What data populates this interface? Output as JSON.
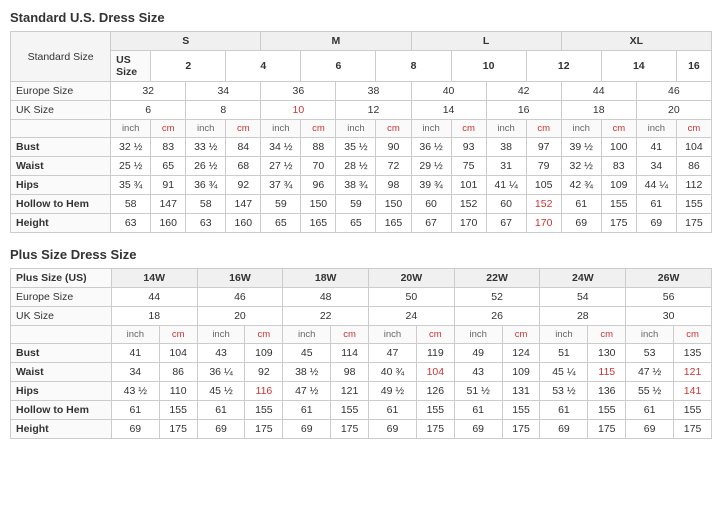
{
  "standard": {
    "title": "Standard U.S. Dress Size",
    "size_groups": [
      "S",
      "M",
      "L",
      "XL"
    ],
    "headers": {
      "standard_size": "Standard Size",
      "us_size": "US Size",
      "europe_size": "Europe Size",
      "uk_size": "UK Size",
      "bust": "Bust",
      "waist": "Waist",
      "hips": "Hips",
      "hollow_to_hem": "Hollow to Hem",
      "height": "Height"
    },
    "us_sizes": [
      "2",
      "4",
      "6",
      "8",
      "10",
      "12",
      "14",
      "16"
    ],
    "europe_sizes": [
      "32",
      "34",
      "36",
      "38",
      "40",
      "42",
      "44",
      "46"
    ],
    "uk_sizes": [
      "6",
      "8",
      "10",
      "12",
      "14",
      "16",
      "18",
      "20"
    ],
    "bust": [
      {
        "inch": "32 ½",
        "cm": "83"
      },
      {
        "inch": "33 ½",
        "cm": "84"
      },
      {
        "inch": "34 ½",
        "cm": "88"
      },
      {
        "inch": "35 ½",
        "cm": "90"
      },
      {
        "inch": "36 ½",
        "cm": "93"
      },
      {
        "inch": "38",
        "cm": "97"
      },
      {
        "inch": "39 ½",
        "cm": "100"
      },
      {
        "inch": "41",
        "cm": "104"
      }
    ],
    "waist": [
      {
        "inch": "25 ½",
        "cm": "65"
      },
      {
        "inch": "26 ½",
        "cm": "68"
      },
      {
        "inch": "27 ½",
        "cm": "70"
      },
      {
        "inch": "28 ½",
        "cm": "72"
      },
      {
        "inch": "29 ½",
        "cm": "75"
      },
      {
        "inch": "31",
        "cm": "79"
      },
      {
        "inch": "32 ½",
        "cm": "83"
      },
      {
        "inch": "34",
        "cm": "86"
      }
    ],
    "hips": [
      {
        "inch": "35 ¾",
        "cm": "91"
      },
      {
        "inch": "36 ¾",
        "cm": "92"
      },
      {
        "inch": "37 ¾",
        "cm": "96"
      },
      {
        "inch": "38 ¾",
        "cm": "98"
      },
      {
        "inch": "39 ¾",
        "cm": "101"
      },
      {
        "inch": "41 ¼",
        "cm": "105"
      },
      {
        "inch": "42 ¾",
        "cm": "109"
      },
      {
        "inch": "44 ¼",
        "cm": "112"
      }
    ],
    "hollow_to_hem": [
      {
        "inch": "58",
        "cm": "147"
      },
      {
        "inch": "58",
        "cm": "147"
      },
      {
        "inch": "59",
        "cm": "150"
      },
      {
        "inch": "59",
        "cm": "150"
      },
      {
        "inch": "60",
        "cm": "152"
      },
      {
        "inch": "60",
        "cm": "152"
      },
      {
        "inch": "61",
        "cm": "155"
      },
      {
        "inch": "61",
        "cm": "155"
      }
    ],
    "height": [
      {
        "inch": "63",
        "cm": "160"
      },
      {
        "inch": "63",
        "cm": "160"
      },
      {
        "inch": "65",
        "cm": "165"
      },
      {
        "inch": "65",
        "cm": "165"
      },
      {
        "inch": "67",
        "cm": "170"
      },
      {
        "inch": "67",
        "cm": "170"
      },
      {
        "inch": "69",
        "cm": "175"
      },
      {
        "inch": "69",
        "cm": "175"
      }
    ]
  },
  "plus": {
    "title": "Plus Size Dress Size",
    "headers": {
      "plus_size": "Plus Size (US)",
      "europe_size": "Europe Size",
      "uk_size": "UK Size",
      "bust": "Bust",
      "waist": "Waist",
      "hips": "Hips",
      "hollow_to_hem": "Hollow to Hem",
      "height": "Height"
    },
    "plus_sizes": [
      "14W",
      "16W",
      "18W",
      "20W",
      "22W",
      "24W",
      "26W"
    ],
    "europe_sizes": [
      "44",
      "46",
      "48",
      "50",
      "52",
      "54",
      "56"
    ],
    "uk_sizes": [
      "18",
      "20",
      "22",
      "24",
      "26",
      "28",
      "30"
    ],
    "bust": [
      {
        "inch": "41",
        "cm": "104"
      },
      {
        "inch": "43",
        "cm": "109"
      },
      {
        "inch": "45",
        "cm": "114"
      },
      {
        "inch": "47",
        "cm": "119"
      },
      {
        "inch": "49",
        "cm": "124"
      },
      {
        "inch": "51",
        "cm": "130"
      },
      {
        "inch": "53",
        "cm": "135"
      }
    ],
    "waist": [
      {
        "inch": "34",
        "cm": "86"
      },
      {
        "inch": "36 ¼",
        "cm": "92"
      },
      {
        "inch": "38 ½",
        "cm": "98"
      },
      {
        "inch": "40 ¾",
        "cm": "104"
      },
      {
        "inch": "43",
        "cm": "109"
      },
      {
        "inch": "45 ¼",
        "cm": "115"
      },
      {
        "inch": "47 ½",
        "cm": "121"
      }
    ],
    "hips": [
      {
        "inch": "43 ½",
        "cm": "110"
      },
      {
        "inch": "45 ½",
        "cm": "116"
      },
      {
        "inch": "47 ½",
        "cm": "121"
      },
      {
        "inch": "49 ½",
        "cm": "126"
      },
      {
        "inch": "51 ½",
        "cm": "131"
      },
      {
        "inch": "53 ½",
        "cm": "136"
      },
      {
        "inch": "55 ½",
        "cm": "141"
      }
    ],
    "hollow_to_hem": [
      {
        "inch": "61",
        "cm": "155"
      },
      {
        "inch": "61",
        "cm": "155"
      },
      {
        "inch": "61",
        "cm": "155"
      },
      {
        "inch": "61",
        "cm": "155"
      },
      {
        "inch": "61",
        "cm": "155"
      },
      {
        "inch": "61",
        "cm": "155"
      },
      {
        "inch": "61",
        "cm": "155"
      }
    ],
    "height": [
      {
        "inch": "69",
        "cm": "175"
      },
      {
        "inch": "69",
        "cm": "175"
      },
      {
        "inch": "69",
        "cm": "175"
      },
      {
        "inch": "69",
        "cm": "175"
      },
      {
        "inch": "69",
        "cm": "175"
      },
      {
        "inch": "69",
        "cm": "175"
      },
      {
        "inch": "69",
        "cm": "175"
      }
    ]
  },
  "unit": {
    "inch": "inch",
    "cm": "cm"
  }
}
